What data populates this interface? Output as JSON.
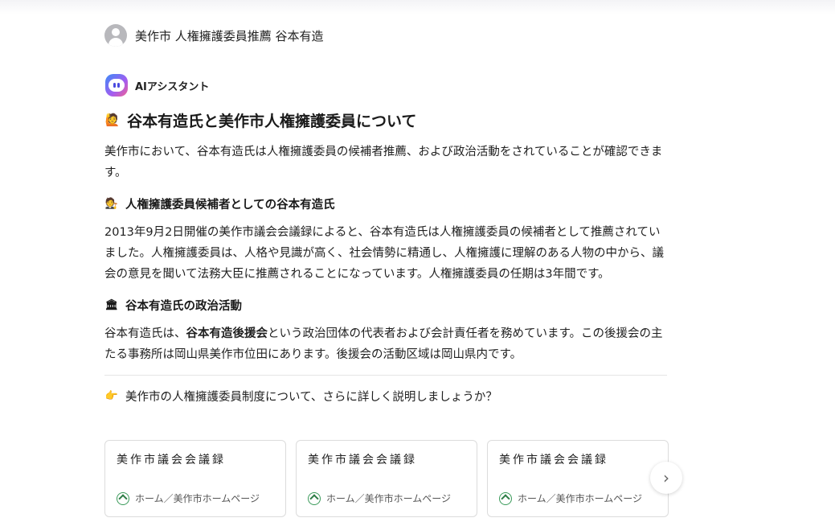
{
  "user_message": "美作市 人権擁護委員推薦 谷本有造",
  "assistant": {
    "name": "AIアシスタント",
    "title_emoji": "🙋",
    "title": "谷本有造氏と美作市人権擁護委員について",
    "intro": "美作市において、谷本有造氏は人権擁護委員の候補者推薦、および政治活動をされていることが確認できます。",
    "section1": {
      "emoji": "🧑‍⚖️",
      "heading": "人権擁護委員候補者としての谷本有造氏",
      "body": "2013年9月2日開催の美作市議会会議録によると、谷本有造氏は人権擁護委員の候補者として推薦されていました。人権擁護委員は、人格や見識が高く、社会情勢に精通し、人権擁護に理解のある人物の中から、議会の意見を聞いて法務大臣に推薦されることになっています。人権擁護委員の任期は3年間です。"
    },
    "section2": {
      "emoji": "🏛",
      "heading": "谷本有造氏の政治活動",
      "body_prefix": "谷本有造氏は、",
      "body_bold": "谷本有造後援会",
      "body_suffix": "という政治団体の代表者および会計責任者を務めています。この後援会の主たる事務所は岡山県美作市位田にあります。後援会の活動区域は岡山県内です。"
    },
    "followup_emoji": "👉",
    "followup": "美作市の人権擁護委員制度について、さらに詳しく説明しましょうか？"
  },
  "references": [
    {
      "title": "美作市議会会議録",
      "source": "ホーム／美作市ホームページ"
    },
    {
      "title": "美作市議会会議録",
      "source": "ホーム／美作市ホームページ"
    },
    {
      "title": "美作市議会会議録",
      "source": "ホーム／美作市ホームページ"
    }
  ],
  "next_button_icon": "chevron-right-icon"
}
